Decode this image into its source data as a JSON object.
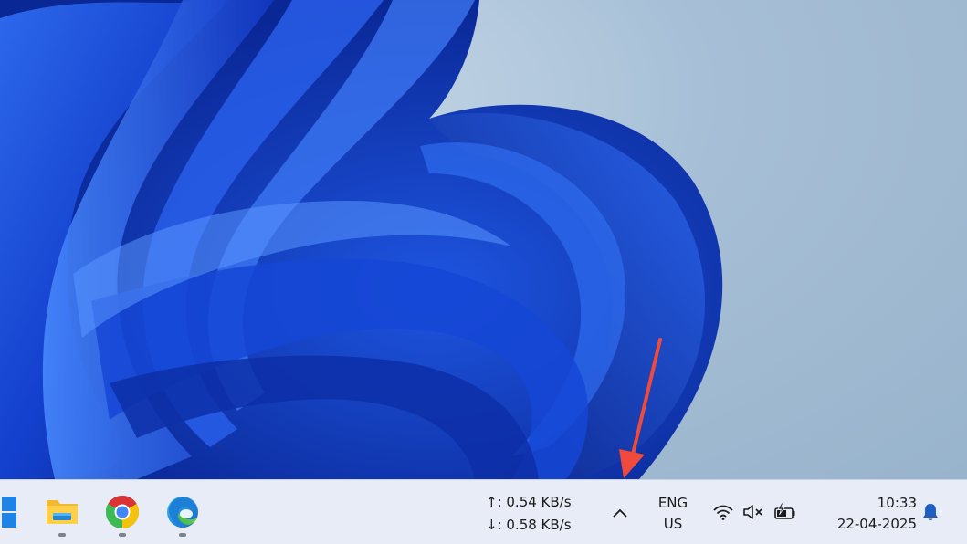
{
  "taskbar": {
    "apps": [
      {
        "name": "File Explorer",
        "icon": "folder-icon",
        "running": true
      },
      {
        "name": "Google Chrome",
        "icon": "chrome-icon",
        "running": true
      },
      {
        "name": "Microsoft Edge",
        "icon": "edge-icon",
        "running": true
      }
    ],
    "network_speed": {
      "upload": "↑: 0.54 KB/s",
      "download": "↓: 0.58 KB/s"
    },
    "language": {
      "line1": "ENG",
      "line2": "US"
    },
    "system_icons": [
      "wifi-icon",
      "speaker-muted-icon",
      "battery-charging-icon"
    ],
    "clock": {
      "time": "10:33",
      "date": "22-04-2025"
    },
    "notification_icon": "bell-icon"
  },
  "colors": {
    "taskbar_bg": "#e7ecf6",
    "wallpaper_blue": "#1a4fd8",
    "arrow": "#f04a3c"
  }
}
